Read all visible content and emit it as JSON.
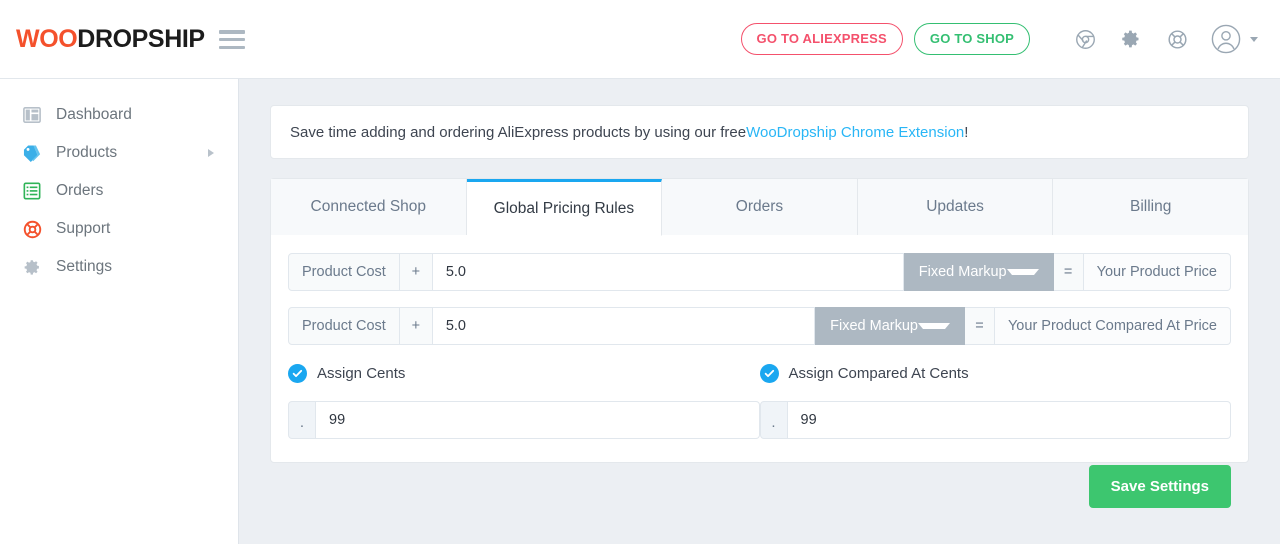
{
  "header": {
    "logo_part1": "WOO",
    "logo_part2": "DROPSHIP",
    "menu_icon": "hamburger-icon",
    "aliexpress_button": "GO TO ALIEXPRESS",
    "shop_button": "GO TO SHOP",
    "icons": [
      "chrome-icon",
      "gear-icon",
      "lifebuoy-icon",
      "user-avatar-icon",
      "chevron-down-icon"
    ],
    "colors": {
      "aliexpress": "#f4516c",
      "shop": "#34bf72",
      "logo_accent": "#f4512c"
    }
  },
  "sidebar": {
    "items": [
      {
        "label": "Dashboard",
        "icon": "dashboard-icon",
        "has_caret": false
      },
      {
        "label": "Products",
        "icon": "tags-icon",
        "has_caret": true
      },
      {
        "label": "Orders",
        "icon": "list-icon",
        "has_caret": false
      },
      {
        "label": "Support",
        "icon": "lifebuoy-icon",
        "has_caret": false
      },
      {
        "label": "Settings",
        "icon": "gear-icon",
        "has_caret": false
      }
    ]
  },
  "banner": {
    "text_before": "Save time adding and ordering AliExpress products by using our free ",
    "link_text": "WooDropship Chrome Extension",
    "text_after": "!",
    "link_color": "#29b6f6"
  },
  "tabs": [
    {
      "label": "Connected Shop",
      "active": false
    },
    {
      "label": "Global Pricing Rules",
      "active": true
    },
    {
      "label": "Orders",
      "active": false
    },
    {
      "label": "Updates",
      "active": false
    },
    {
      "label": "Billing",
      "active": false
    }
  ],
  "pricing_rows": [
    {
      "cost_label": "Product Cost",
      "operator": "+",
      "value": "5.0",
      "markup_type": "Fixed Markup",
      "equals": "=",
      "result_label": "Your Product Price"
    },
    {
      "cost_label": "Product Cost",
      "operator": "+",
      "value": "5.0",
      "markup_type": "Fixed Markup",
      "equals": "=",
      "result_label": "Your Product Compared At Price"
    }
  ],
  "cents": [
    {
      "checkbox_label": "Assign Cents",
      "checked": true,
      "prefix": ".",
      "value": "99"
    },
    {
      "checkbox_label": "Assign Compared At Cents",
      "checked": true,
      "prefix": ".",
      "value": "99"
    }
  ],
  "footer": {
    "save_label": "Save Settings",
    "save_color": "#3dc66f"
  }
}
